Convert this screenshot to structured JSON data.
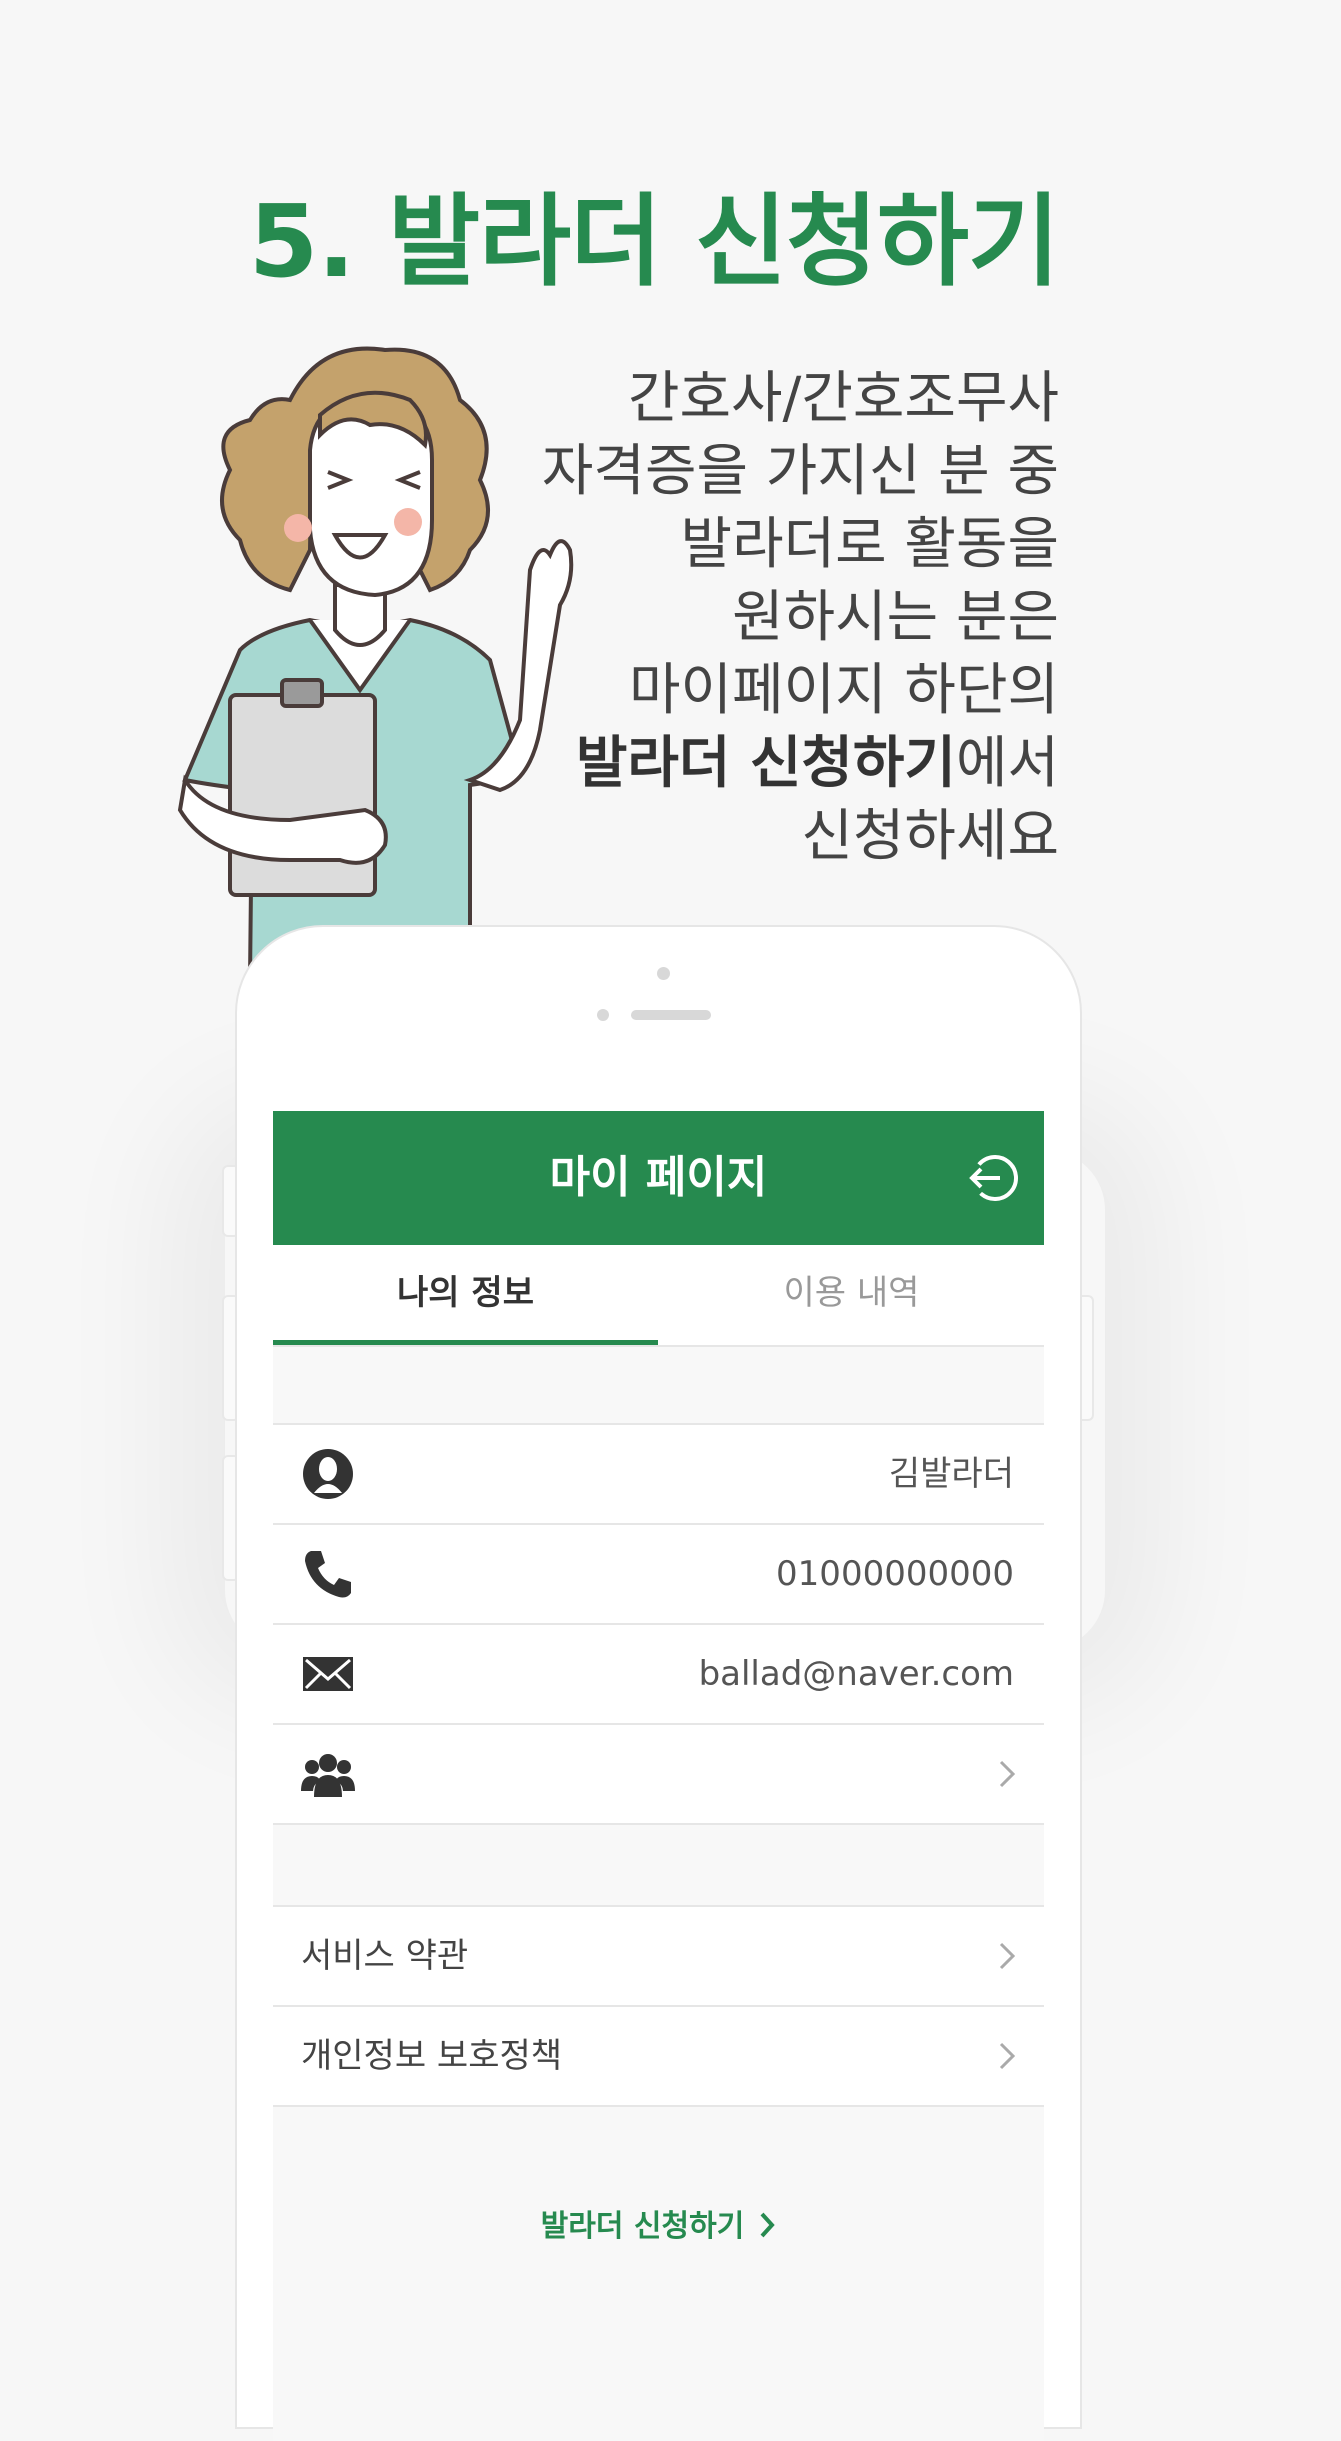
{
  "headline": "5. 발라더 신청하기",
  "description": {
    "lines": [
      "간호사/간호조무사",
      "자격증을 가지신 분 중",
      "발라더로 활동을",
      "원하시는 분은",
      "마이페이지 하단의"
    ],
    "bold_phrase": "발라더 신청하기",
    "after_bold": "에서",
    "last_line": "신청하세요"
  },
  "app": {
    "title": "마이 페이지",
    "logout_icon": "logout-icon",
    "tabs": [
      {
        "label": "나의 정보",
        "active": true
      },
      {
        "label": "이용 내역",
        "active": false
      }
    ],
    "info_rows": [
      {
        "icon": "person-icon",
        "value": "김발라더"
      },
      {
        "icon": "phone-icon",
        "value": "01000000000"
      },
      {
        "icon": "mail-icon",
        "value": "ballad@naver.com"
      },
      {
        "icon": "group-icon",
        "value": ""
      }
    ],
    "menu_items": [
      {
        "label": "서비스 약관"
      },
      {
        "label": "개인정보 보호정책"
      }
    ],
    "apply_link": "발라더 신청하기"
  },
  "colors": {
    "accent": "#268a4f",
    "background": "#f7f7f7",
    "scrubs": "#a7d8d1",
    "hair": "#c4a26c"
  }
}
